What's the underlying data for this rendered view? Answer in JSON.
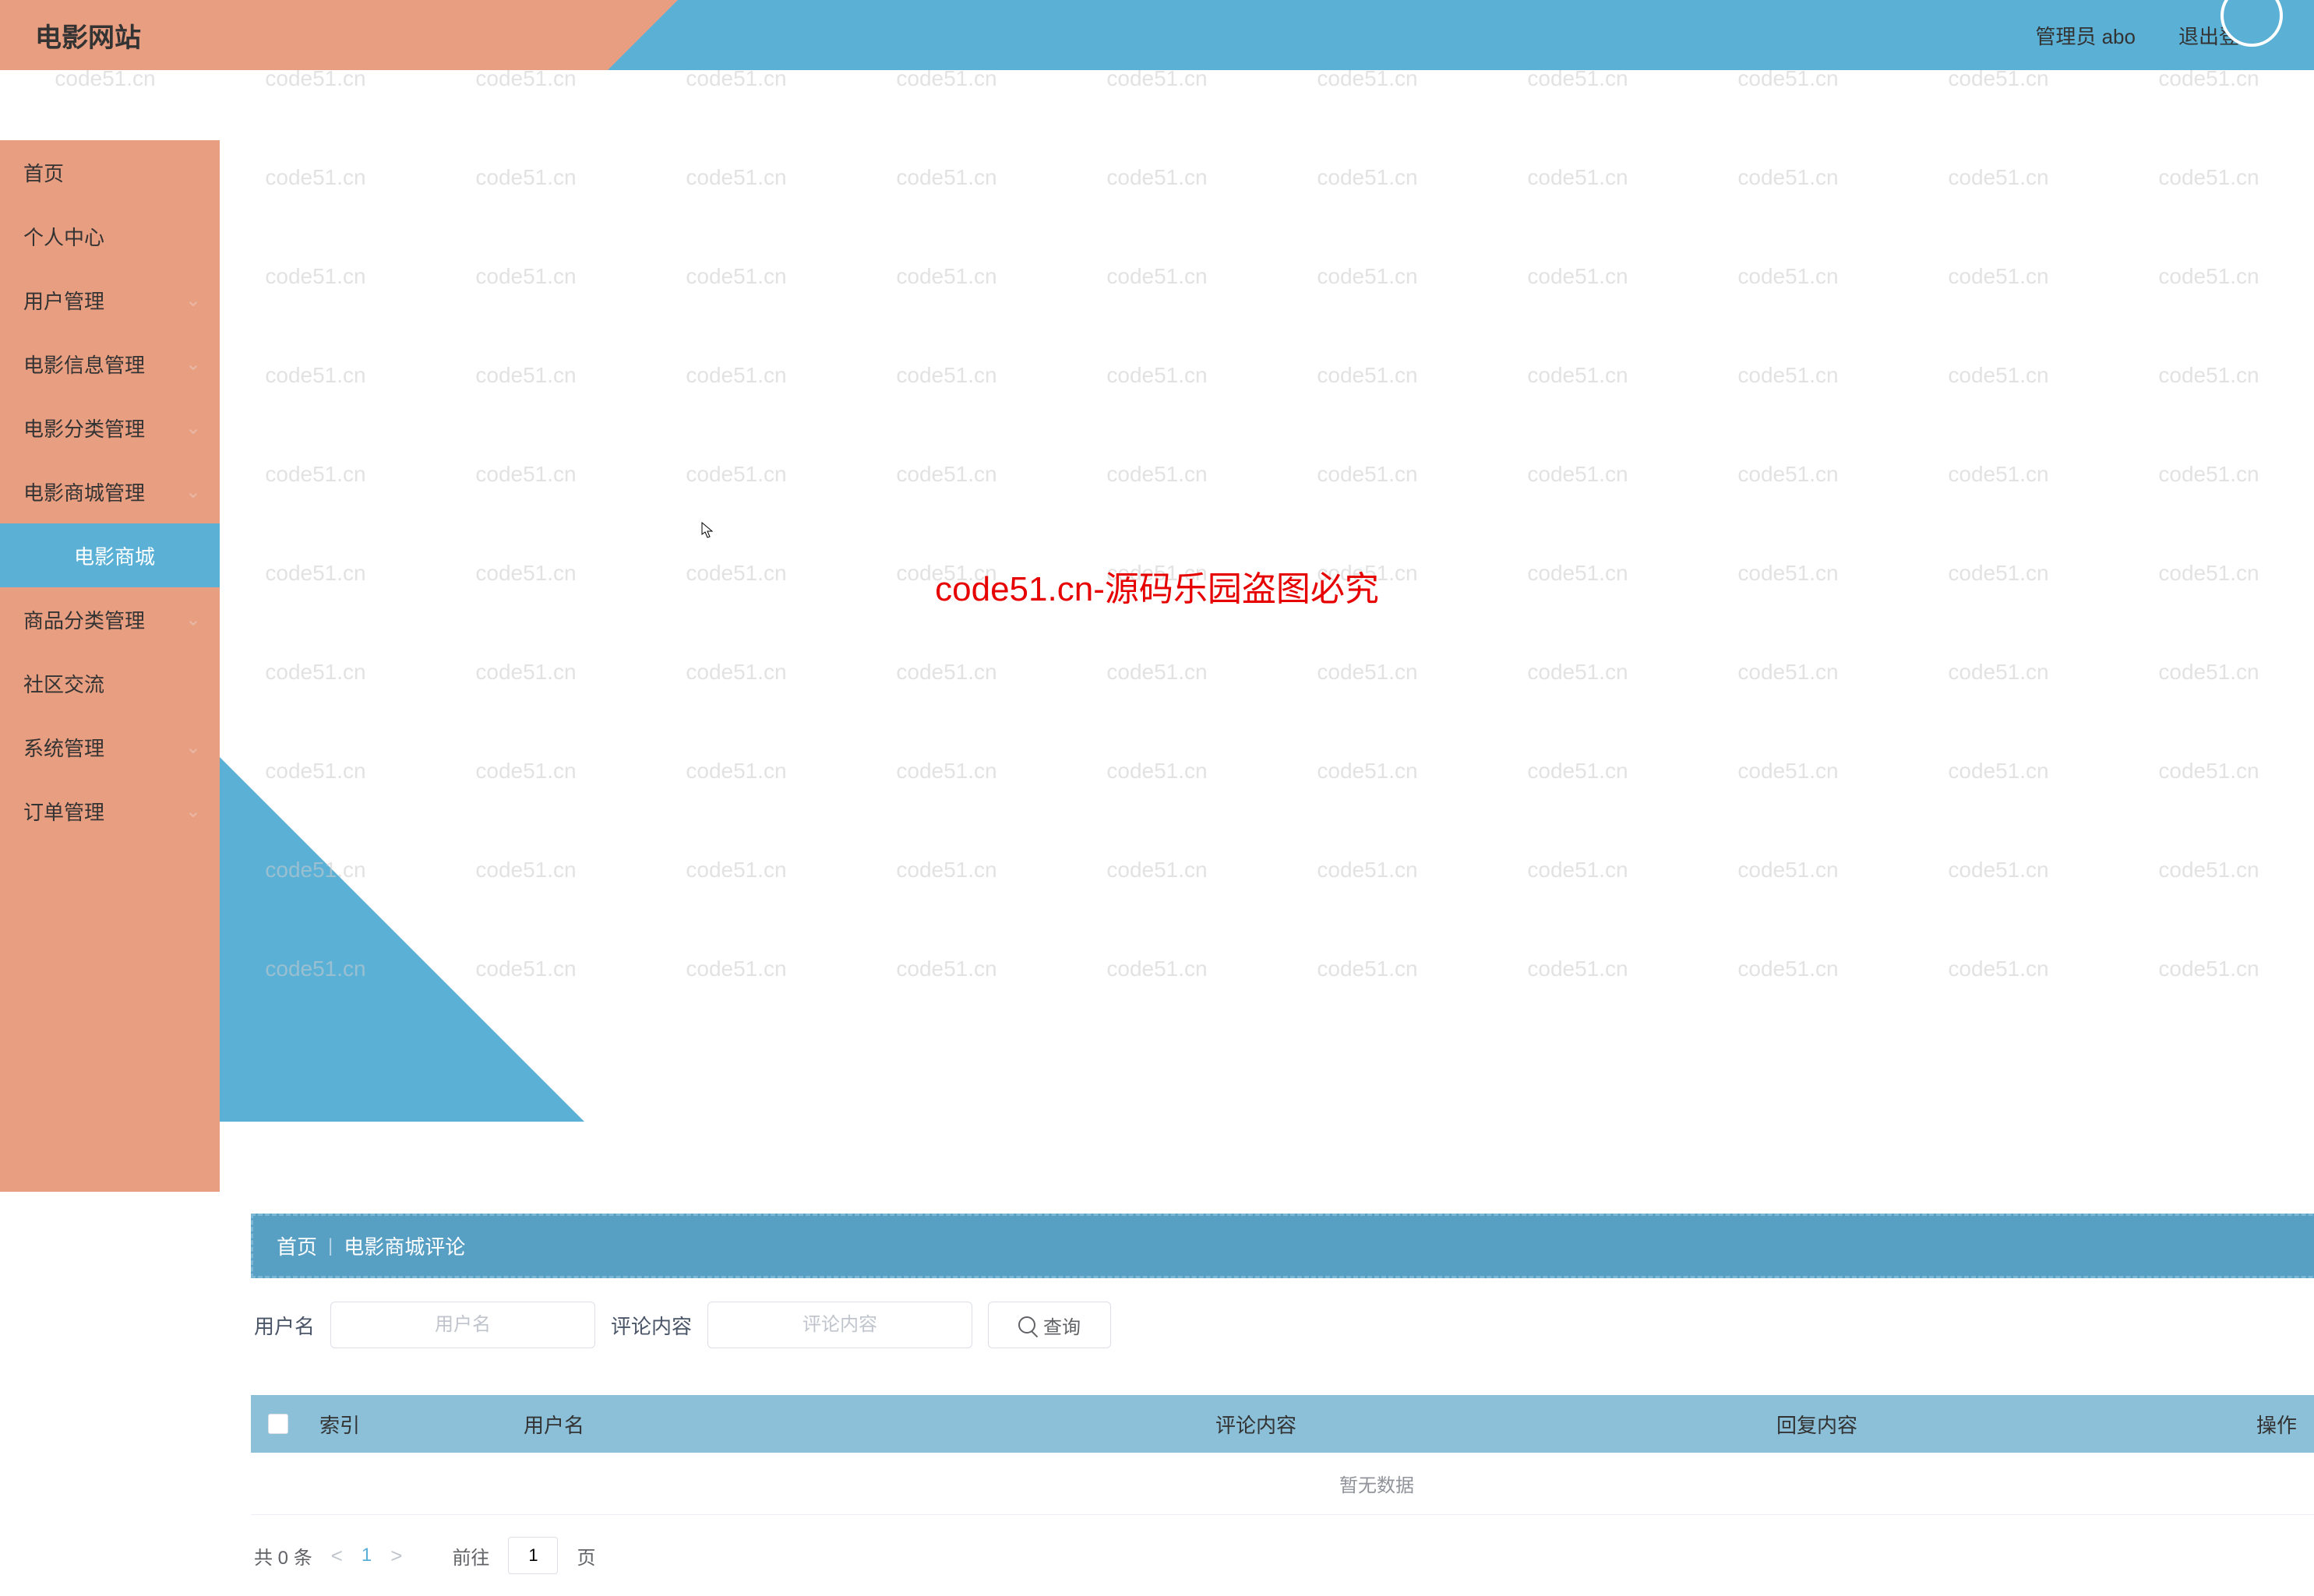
{
  "site": {
    "title": "电影网站"
  },
  "header": {
    "admin_label": "管理员 abo",
    "logout_label": "退出登录"
  },
  "sidebar": {
    "items": [
      {
        "label": "首页",
        "active": false,
        "has_sub": false
      },
      {
        "label": "个人中心",
        "active": false,
        "has_sub": false
      },
      {
        "label": "用户管理",
        "active": false,
        "has_sub": true
      },
      {
        "label": "电影信息管理",
        "active": false,
        "has_sub": true
      },
      {
        "label": "电影分类管理",
        "active": false,
        "has_sub": true
      },
      {
        "label": "电影商城管理",
        "active": false,
        "has_sub": true
      },
      {
        "label": "电影商城",
        "active": true,
        "has_sub": false
      },
      {
        "label": "商品分类管理",
        "active": false,
        "has_sub": true
      },
      {
        "label": "社区交流",
        "active": false,
        "has_sub": false
      },
      {
        "label": "系统管理",
        "active": false,
        "has_sub": true
      },
      {
        "label": "订单管理",
        "active": false,
        "has_sub": true
      }
    ]
  },
  "breadcrumb": {
    "home": "首页",
    "current": "电影商城评论"
  },
  "search": {
    "user_label": "用户名",
    "user_placeholder": "用户名",
    "comment_label": "评论内容",
    "comment_placeholder": "评论内容",
    "button_label": "查询"
  },
  "table": {
    "columns": {
      "index": "索引",
      "username": "用户名",
      "comment": "评论内容",
      "reply": "回复内容",
      "operation": "操作"
    },
    "empty_text": "暂无数据",
    "rows": []
  },
  "pagination": {
    "total_prefix": "共",
    "total_count": "0",
    "total_suffix": "条",
    "current_page": "1",
    "goto_prefix": "前往",
    "goto_value": "1",
    "goto_suffix": "页"
  },
  "watermark": {
    "text": "code51.cn",
    "center_text": "code51.cn-源码乐园盗图必究"
  }
}
